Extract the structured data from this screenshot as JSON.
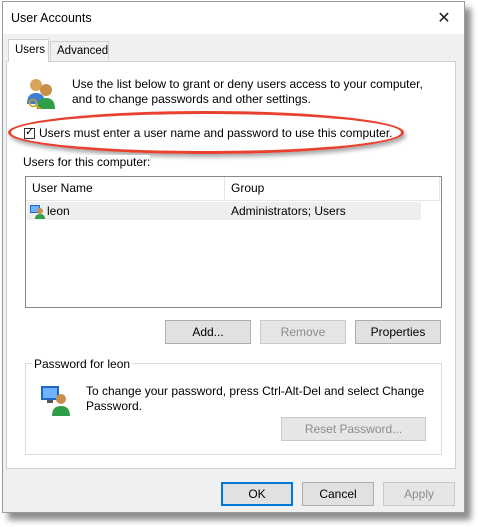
{
  "window": {
    "title": "User Accounts",
    "close_glyph": "✕"
  },
  "tabs": [
    {
      "label": "Users",
      "active": true
    },
    {
      "label": "Advanced",
      "active": false
    }
  ],
  "intro": {
    "icon": "users-icon",
    "text": "Use the list below to grant or deny users access to your computer, and to change passwords and other settings."
  },
  "require_login": {
    "checked": true,
    "label": "Users must enter a user name and password to use this computer."
  },
  "users_section": {
    "label": "Users for this computer:",
    "columns": [
      "User Name",
      "Group"
    ],
    "rows": [
      {
        "icon": "user-icon",
        "name": "leon",
        "group": "Administrators; Users"
      }
    ]
  },
  "user_buttons": {
    "add": "Add...",
    "remove": "Remove",
    "properties": "Properties"
  },
  "password_section": {
    "label": "Password for leon",
    "icon": "user-password-icon",
    "text": "To change your password, press Ctrl-Alt-Del and select Change Password.",
    "reset": "Reset Password..."
  },
  "dialog_buttons": {
    "ok": "OK",
    "cancel": "Cancel",
    "apply": "Apply"
  },
  "colors": {
    "highlight": "#e8412f",
    "default_button_border": "#0078d7"
  }
}
